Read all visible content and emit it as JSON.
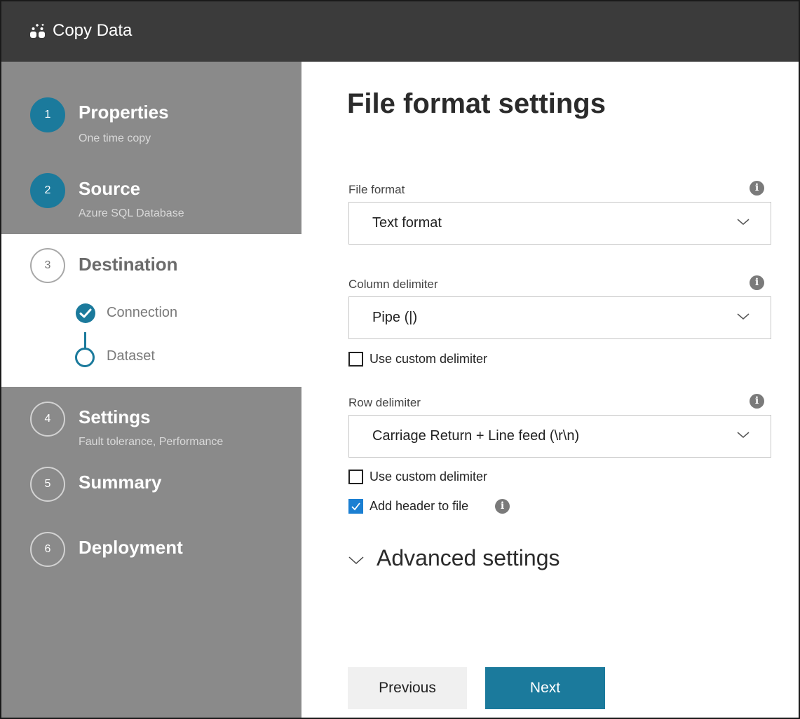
{
  "app": {
    "title": "Copy Data",
    "icon": "copy-data-icon"
  },
  "steps": [
    {
      "number": "1",
      "title": "Properties",
      "subtitle": "One time copy",
      "state": "done"
    },
    {
      "number": "2",
      "title": "Source",
      "subtitle": "Azure SQL Database",
      "state": "done"
    },
    {
      "number": "3",
      "title": "Destination",
      "subtitle": "",
      "state": "current",
      "substeps": [
        {
          "label": "Connection",
          "state": "done"
        },
        {
          "label": "Dataset",
          "state": "current"
        }
      ]
    },
    {
      "number": "4",
      "title": "Settings",
      "subtitle": "Fault tolerance, Performance",
      "state": "todo"
    },
    {
      "number": "5",
      "title": "Summary",
      "subtitle": "",
      "state": "todo"
    },
    {
      "number": "6",
      "title": "Deployment",
      "subtitle": "",
      "state": "todo"
    }
  ],
  "page": {
    "title": "File format settings",
    "file_format": {
      "label": "File format",
      "value": "Text format"
    },
    "column_delimiter": {
      "label": "Column delimiter",
      "value": "Pipe (|)",
      "custom_label": "Use custom delimiter",
      "custom_checked": false
    },
    "row_delimiter": {
      "label": "Row delimiter",
      "value": "Carriage Return + Line feed (\\r\\n)",
      "custom_label": "Use custom delimiter",
      "custom_checked": false
    },
    "header": {
      "label": "Add header to file",
      "checked": true
    },
    "advanced_label": "Advanced settings",
    "info_glyph": "i"
  },
  "buttons": {
    "previous": "Previous",
    "next": "Next"
  },
  "colors": {
    "accent": "#1b7a9c",
    "titlebar": "#3b3b3b",
    "sidebar": "#8a8a8a",
    "checkbox": "#1b7fd2"
  }
}
